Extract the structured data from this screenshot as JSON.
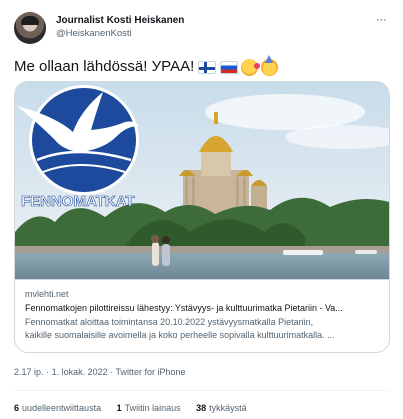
{
  "author": {
    "display_name": "Journalist Kosti Heiskanen",
    "handle": "@HeiskanenKosti"
  },
  "more_label": "···",
  "tweet": {
    "text": "Me ollaan lähdössä! УРАА!",
    "emoji": [
      "flag-finland",
      "flag-russia",
      "face-blowing-kiss",
      "partying-face"
    ]
  },
  "card": {
    "logo_text": "FENNOMATKAT",
    "domain": "mvlehti.net",
    "title": "Fennomatkojen pilottireissu lähestyy: Ystävyys- ja kulttuurimatka Pietariin - Va...",
    "description_line1": "Fennomatkat aloittaa toimintansa 20.10.2022 ystävyysmatkalla Pietariin,",
    "description_line2": "kaikille suomalaisille avoimella ja koko perheelle sopivalla kulttuurimatkalla. ..."
  },
  "meta": {
    "time": "2.17 ip.",
    "date": "1. lokak. 2022",
    "separator": "·",
    "source": "Twitter for iPhone"
  },
  "stats": {
    "retweets_count": "6",
    "retweets_label": "uudelleentwiittausta",
    "quotes_count": "1",
    "quotes_label": "Twiitin lainaus",
    "likes_count": "38",
    "likes_label": "tykkäystä"
  },
  "colors": {
    "text_primary": "#0f1419",
    "text_secondary": "#536471",
    "border": "#cfd9de",
    "logo_blue": "#1d4a9c"
  }
}
